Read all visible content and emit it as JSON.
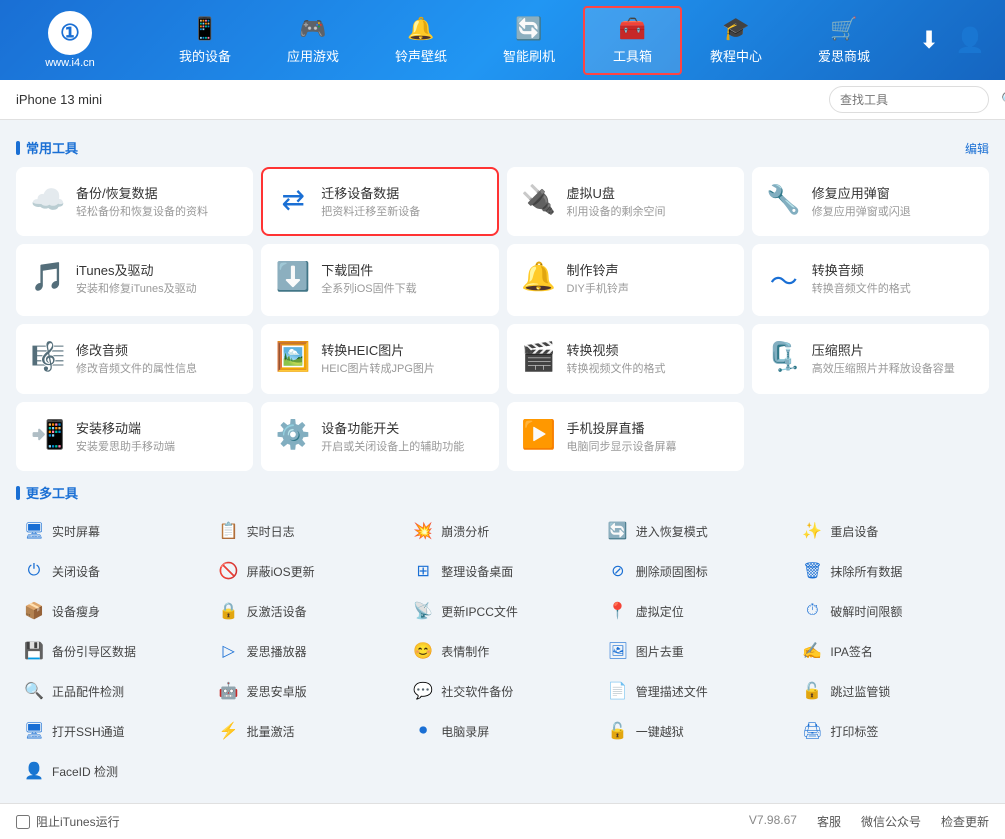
{
  "header": {
    "logo_text": "i4",
    "logo_subtext": "www.i4.cn",
    "nav_items": [
      {
        "id": "my-device",
        "label": "我的设备",
        "icon": "📱"
      },
      {
        "id": "apps",
        "label": "应用游戏",
        "icon": "🎮"
      },
      {
        "id": "ringtone",
        "label": "铃声壁纸",
        "icon": "🔔"
      },
      {
        "id": "smart-flash",
        "label": "智能刷机",
        "icon": "🔄"
      },
      {
        "id": "toolbox",
        "label": "工具箱",
        "icon": "🧰",
        "active": true
      },
      {
        "id": "tutorial",
        "label": "教程中心",
        "icon": "🎓"
      },
      {
        "id": "store",
        "label": "爱思商城",
        "icon": "🛒"
      }
    ]
  },
  "sub_header": {
    "device_name": "iPhone 13 mini",
    "search_placeholder": "查找工具"
  },
  "common_tools_title": "常用工具",
  "edit_label": "编辑",
  "common_tools": [
    {
      "id": "backup-restore",
      "icon": "☁",
      "name": "备份/恢复数据",
      "desc": "轻松备份和恢复设备的资料",
      "highlighted": false
    },
    {
      "id": "migrate-data",
      "icon": "⇄",
      "name": "迁移设备数据",
      "desc": "把资料迁移至新设备",
      "highlighted": true
    },
    {
      "id": "virtual-usb",
      "icon": "🔌",
      "name": "虚拟U盘",
      "desc": "利用设备的剩余空间",
      "highlighted": false
    },
    {
      "id": "fix-app-popup",
      "icon": "🔧",
      "name": "修复应用弹窗",
      "desc": "修复应用弹窗或闪退",
      "highlighted": false
    },
    {
      "id": "itunes-driver",
      "icon": "♫",
      "name": "iTunes及驱动",
      "desc": "安装和修复iTunes及驱动",
      "highlighted": false
    },
    {
      "id": "download-firmware",
      "icon": "⬇",
      "name": "下载固件",
      "desc": "全系列iOS固件下载",
      "highlighted": false
    },
    {
      "id": "make-ringtone",
      "icon": "🎵",
      "name": "制作铃声",
      "desc": "DIY手机铃声",
      "highlighted": false
    },
    {
      "id": "convert-audio",
      "icon": "〜",
      "name": "转换音频",
      "desc": "转换音频文件的格式",
      "highlighted": false
    },
    {
      "id": "edit-audio",
      "icon": "🎼",
      "name": "修改音频",
      "desc": "修改音频文件的属性信息",
      "highlighted": false
    },
    {
      "id": "convert-heic",
      "icon": "🖼",
      "name": "转换HEIC图片",
      "desc": "HEIC图片转成JPG图片",
      "highlighted": false
    },
    {
      "id": "convert-video",
      "icon": "🎬",
      "name": "转换视频",
      "desc": "转换视频文件的格式",
      "highlighted": false
    },
    {
      "id": "compress-photo",
      "icon": "🗜",
      "name": "压缩照片",
      "desc": "高效压缩照片并释放设备容量",
      "highlighted": false
    },
    {
      "id": "install-mobile",
      "icon": "📲",
      "name": "安装移动端",
      "desc": "安装爱思助手移动端",
      "highlighted": false
    },
    {
      "id": "device-features",
      "icon": "⚙",
      "name": "设备功能开关",
      "desc": "开启或关闭设备上的辅助功能",
      "highlighted": false
    },
    {
      "id": "screen-mirror",
      "icon": "▶",
      "name": "手机投屏直播",
      "desc": "电脑同步显示设备屏幕",
      "highlighted": false
    }
  ],
  "more_tools_title": "更多工具",
  "more_tools": [
    {
      "id": "realtime-screen",
      "icon": "🖥",
      "name": "实时屏幕"
    },
    {
      "id": "realtime-log",
      "icon": "📋",
      "name": "实时日志"
    },
    {
      "id": "crash-analysis",
      "icon": "💥",
      "name": "崩溃分析"
    },
    {
      "id": "enter-recovery",
      "icon": "🔄",
      "name": "进入恢复模式"
    },
    {
      "id": "restart-device",
      "icon": "✨",
      "name": "重启设备"
    },
    {
      "id": "shutdown",
      "icon": "⏻",
      "name": "关闭设备"
    },
    {
      "id": "block-ios-update",
      "icon": "🚫",
      "name": "屏蔽iOS更新"
    },
    {
      "id": "organize-desktop",
      "icon": "⊞",
      "name": "整理设备桌面"
    },
    {
      "id": "delete-stubborn-icon",
      "icon": "⊘",
      "name": "删除顽固图标"
    },
    {
      "id": "wipe-all-data",
      "icon": "🗑",
      "name": "抹除所有数据"
    },
    {
      "id": "slim-device",
      "icon": "📦",
      "name": "设备瘦身"
    },
    {
      "id": "deactivate",
      "icon": "🔒",
      "name": "反激活设备"
    },
    {
      "id": "update-ipcc",
      "icon": "📡",
      "name": "更新IPCC文件"
    },
    {
      "id": "fake-location",
      "icon": "📍",
      "name": "虚拟定位"
    },
    {
      "id": "break-time-limit",
      "icon": "⏱",
      "name": "破解时间限额"
    },
    {
      "id": "backup-partition",
      "icon": "💾",
      "name": "备份引导区数据"
    },
    {
      "id": "aisii-player",
      "icon": "▷",
      "name": "爱思播放器"
    },
    {
      "id": "make-emoji",
      "icon": "😊",
      "name": "表情制作"
    },
    {
      "id": "photo-recount",
      "icon": "🖼",
      "name": "图片去重"
    },
    {
      "id": "ipa-sign",
      "icon": "✍",
      "name": "IPA签名"
    },
    {
      "id": "genuine-parts",
      "icon": "🔍",
      "name": "正品配件检测"
    },
    {
      "id": "aisii-android",
      "icon": "🤖",
      "name": "爱思安卓版"
    },
    {
      "id": "social-backup",
      "icon": "💬",
      "name": "社交软件备份"
    },
    {
      "id": "manage-desc",
      "icon": "📄",
      "name": "管理描述文件"
    },
    {
      "id": "skip-supervision",
      "icon": "🔓",
      "name": "跳过监管锁"
    },
    {
      "id": "open-ssh",
      "icon": "🖥",
      "name": "打开SSH通道"
    },
    {
      "id": "batch-activate",
      "icon": "⚡",
      "name": "批量激活"
    },
    {
      "id": "pc-record",
      "icon": "⏺",
      "name": "电脑录屏"
    },
    {
      "id": "one-click-jailbreak",
      "icon": "🔓",
      "name": "一键越狱"
    },
    {
      "id": "print-label",
      "icon": "🖨",
      "name": "打印标签"
    },
    {
      "id": "faceid-detect",
      "icon": "👤",
      "name": "FaceID 检测"
    }
  ],
  "footer": {
    "checkbox_label": "阻止iTunes运行",
    "version": "V7.98.67",
    "customer_service": "客服",
    "wechat": "微信公众号",
    "check_update": "检查更新"
  }
}
